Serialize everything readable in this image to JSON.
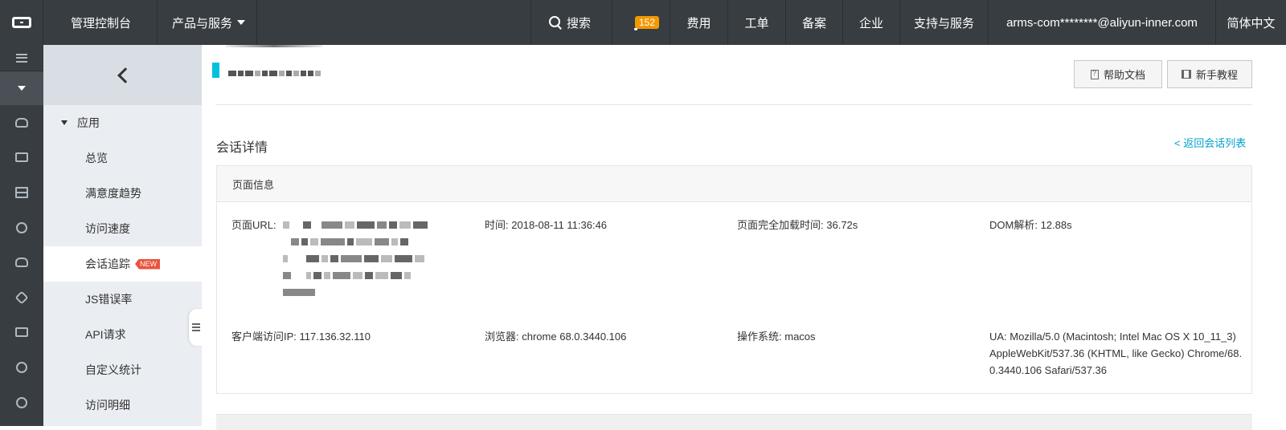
{
  "topbar": {
    "console": "管理控制台",
    "products": "产品与服务",
    "search": "搜索",
    "notifications_count": "152",
    "fee": "费用",
    "ticket": "工单",
    "beian": "备案",
    "enterprise": "企业",
    "support": "支持与服务",
    "account": "arms-com********@aliyun-inner.com",
    "language": "简体中文"
  },
  "iconbar": {
    "icons": [
      "menu-icon",
      "dropdown-icon",
      "cloud-icon",
      "ecs-icon",
      "database-icon",
      "network-icon",
      "cloud-upload-icon",
      "hexagon-icon",
      "cdn-icon",
      "dev-icon",
      "cluster-icon"
    ]
  },
  "sidebar": {
    "group": "应用",
    "items": [
      "总览",
      "满意度趋势",
      "访问速度",
      "会话追踪",
      "JS错误率",
      "API请求",
      "自定义统计",
      "访问明细"
    ],
    "new_badge": "NEW"
  },
  "header": {
    "help_doc": "帮助文档",
    "tutorial": "新手教程"
  },
  "section": {
    "title": "会话详情",
    "back_link": "< 返回会话列表"
  },
  "page_info": {
    "heading": "页面信息",
    "url_label": "页面URL:",
    "time_label": "时间:",
    "time_value": "2018-08-11 11:36:46",
    "load_label": "页面完全加载时间:",
    "load_value": "36.72s",
    "dom_label": "DOM解析:",
    "dom_value": "12.88s",
    "ip_label": "客户端访问IP:",
    "ip_value": "117.136.32.110",
    "browser_label": "浏览器:",
    "browser_value": "chrome 68.0.3440.106",
    "os_label": "操作系统:",
    "os_value": "macos",
    "ua_label": "UA:",
    "ua_value": "Mozilla/5.0 (Macintosh; Intel Mac OS X 10_11_3) AppleWebKit/537.36 (KHTML, like Gecko) Chrome/68.0.3440.106 Safari/537.36"
  },
  "colors": {
    "topbar": "#373d41",
    "accent": "#00c1de",
    "link": "#00a2ca",
    "badge": "#f39800",
    "new_tag": "#e9533e"
  }
}
